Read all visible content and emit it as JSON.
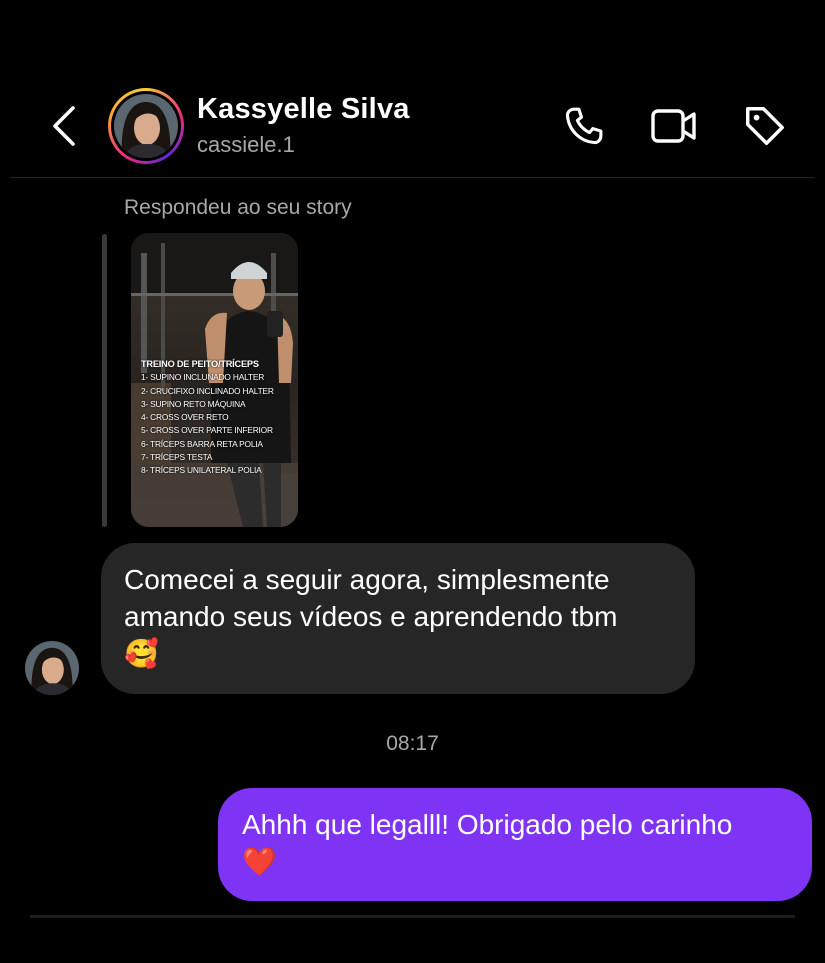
{
  "header": {
    "name": "Kassyelle Silva",
    "username": "cassiele.1",
    "icons": [
      "back-chevron-icon",
      "phone-icon",
      "video-camera-icon",
      "tag-icon"
    ]
  },
  "story_reply": {
    "caption": "Respondeu ao seu story",
    "story_text": {
      "title": "TREINO DE PEITO/TRÍCEPS",
      "items": [
        "1- SUPINO INCLUNADO HALTER",
        "2- CRUCIFIXO INCLINADO HALTER",
        "3- SUPINO RETO MÁQUINA",
        "4- CROSS OVER RETO",
        "5- CROSS OVER PARTE INFERIOR",
        "6- TRÍCEPS BARRA RETA POLIA",
        "7- TRÍCEPS TESTA",
        "8- TRÍCEPS UNILATERAL POLIA"
      ]
    }
  },
  "messages": [
    {
      "direction": "incoming",
      "text": "Comecei a seguir agora, simplesmente amando seus vídeos e aprendendo tbm",
      "emoji": "🥰"
    },
    {
      "direction": "outgoing",
      "text": "Ahhh que legalll! Obrigado pelo carinho",
      "emoji": "❤️"
    }
  ],
  "timestamp": "08:17",
  "colors": {
    "background": "#000000",
    "incoming_bubble": "#262626",
    "outgoing_bubble": "#7f34f5",
    "secondary_text": "#a8a8a8"
  }
}
